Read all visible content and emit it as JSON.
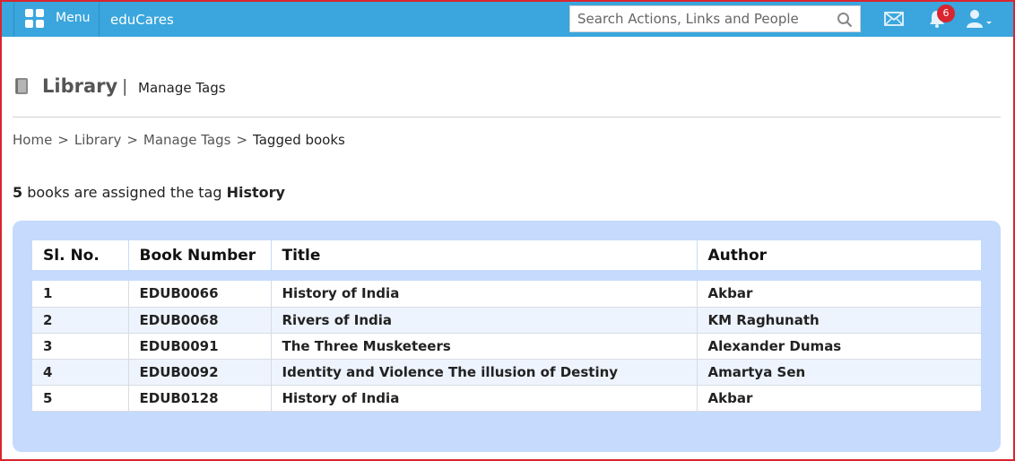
{
  "header": {
    "menu_label": "Menu",
    "brand": "eduCares",
    "search_placeholder": "Search Actions, Links and People",
    "notification_count": "6",
    "icons": [
      "menu-grid-icon",
      "search-icon",
      "mail-icon",
      "bell-icon",
      "user-icon"
    ]
  },
  "page": {
    "title": "Library",
    "separator": "|",
    "subtitle": "Manage Tags"
  },
  "breadcrumb": {
    "items": [
      "Home",
      "Library",
      "Manage Tags"
    ],
    "current": "Tagged books",
    "separator": ">"
  },
  "summary": {
    "count": "5",
    "text": " books are assigned the tag ",
    "tag": "History"
  },
  "table": {
    "columns": [
      "Sl. No.",
      "Book Number",
      "Title",
      "Author"
    ],
    "rows": [
      [
        "1",
        "EDUB0066",
        "History of India",
        "Akbar"
      ],
      [
        "2",
        "EDUB0068",
        "Rivers of India",
        "KM Raghunath"
      ],
      [
        "3",
        "EDUB0091",
        "The Three Musketeers",
        "Alexander Dumas"
      ],
      [
        "4",
        "EDUB0092",
        "Identity and Violence The illusion of Destiny",
        "Amartya Sen"
      ],
      [
        "5",
        "EDUB0128",
        "History of India",
        "Akbar"
      ]
    ]
  },
  "colors": {
    "topbar": "#3aa6dd",
    "panel": "#c5dafd",
    "frame": "#d9252f",
    "badge": "#d9252f"
  }
}
